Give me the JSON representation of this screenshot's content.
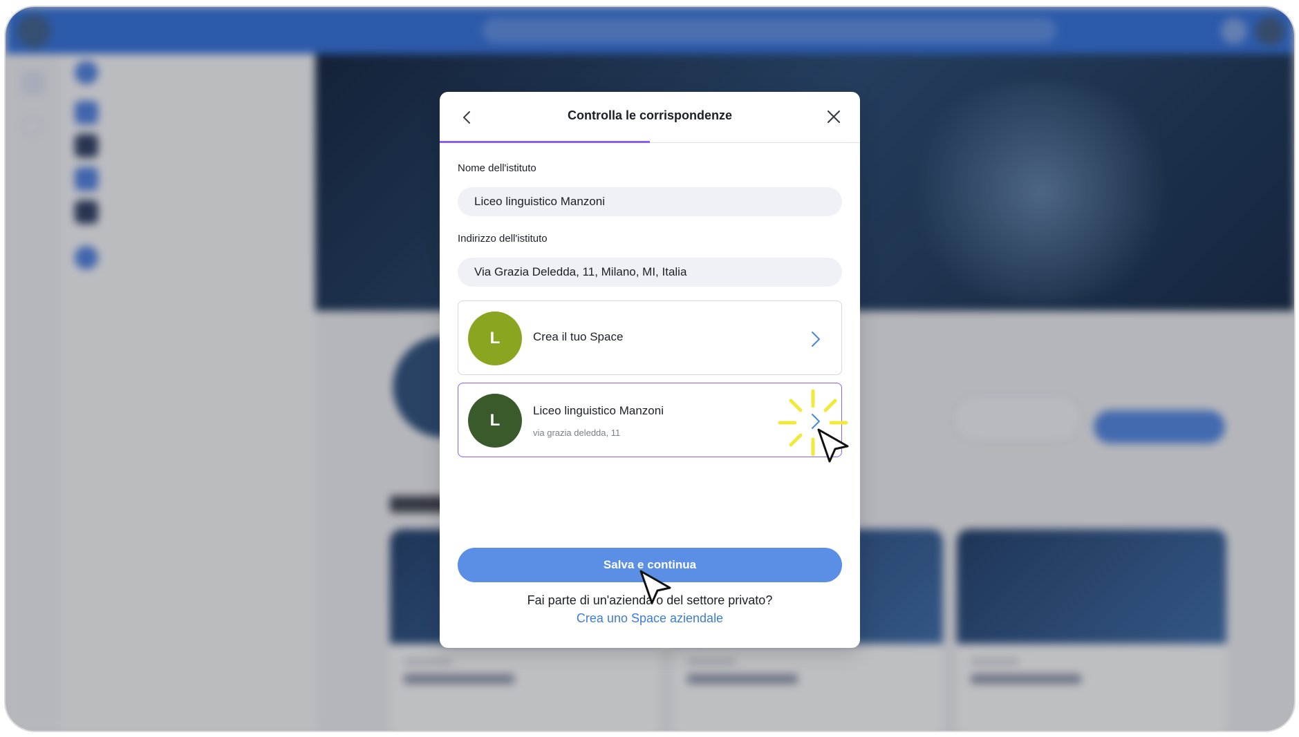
{
  "modal": {
    "title": "Controlla le corrispondenze",
    "institute_name_label": "Nome dell'istituto",
    "institute_name_value": "Liceo linguistico Manzoni",
    "institute_address_label": "Indirizzo dell'istituto",
    "institute_address_value": "Via Grazia Deledda, 11, Milano, MI, Italia",
    "progress_fraction": 0.5,
    "options": [
      {
        "avatar_letter": "L",
        "avatar_color": "#8aa51f",
        "title": "Crea il tuo Space",
        "subtitle": ""
      },
      {
        "avatar_letter": "L",
        "avatar_color": "#3a5a2b",
        "title": "Liceo linguistico Manzoni",
        "subtitle": "via grazia deledda, 11",
        "selected": true
      }
    ],
    "primary_button": "Salva e continua",
    "question": "Fai parte di un'azienda o del settore privato?",
    "link": "Crea uno Space aziendale"
  },
  "colors": {
    "accent_purple": "#8b5cf6",
    "primary_blue": "#5b8fe6",
    "link_blue": "#3d7bd9",
    "topbar_blue": "#2f6fdd"
  },
  "icons": {
    "back": "chevron-left-icon",
    "close": "close-icon",
    "option_chevron": "chevron-right-icon",
    "cursor": "mouse-pointer-icon",
    "highlight": "click-burst-icon"
  }
}
